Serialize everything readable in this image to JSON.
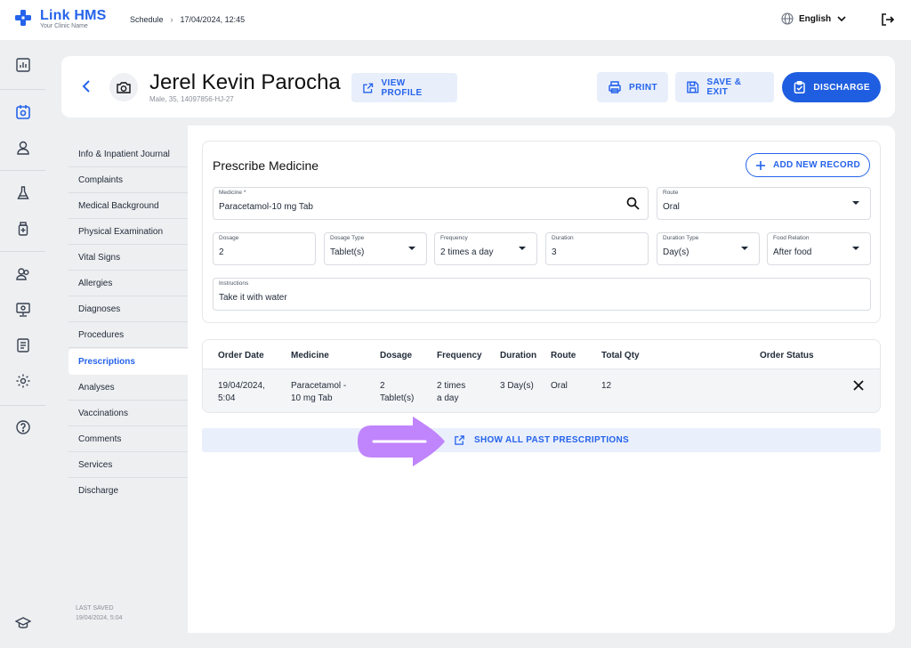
{
  "brand": {
    "name": "Link HMS",
    "subtitle": "Your Clinic Name"
  },
  "breadcrumb": {
    "section": "Schedule",
    "datetime": "17/04/2024, 12:45"
  },
  "language": "English",
  "patient": {
    "name": "Jerel Kevin Parocha",
    "meta": "Male, 35, 14097856-HJ-27",
    "view_profile": "VIEW PROFILE"
  },
  "actions": {
    "print": "PRINT",
    "save_exit": "SAVE & EXIT",
    "discharge": "DISCHARGE"
  },
  "sections": [
    "Info & Inpatient Journal",
    "Complaints",
    "Medical Background",
    "Physical Examination",
    "Vital Signs",
    "Allergies",
    "Diagnoses",
    "Procedures",
    "Prescriptions",
    "Analyses",
    "Vaccinations",
    "Comments",
    "Services",
    "Discharge"
  ],
  "active_section": "Prescriptions",
  "last_saved": {
    "label": "LAST SAVED",
    "value": "19/04/2024, 5:04"
  },
  "prescribe": {
    "title": "Prescribe Medicine",
    "add_record": "ADD NEW RECORD",
    "medicine": {
      "label": "Medicine *",
      "value": "Paracetamol-10 mg Tab"
    },
    "route": {
      "label": "Route",
      "value": "Oral"
    },
    "dosage": {
      "label": "Dosage",
      "value": "2"
    },
    "dosage_type": {
      "label": "Dosage Type",
      "value": "Tablet(s)"
    },
    "frequency": {
      "label": "Frequency",
      "value": "2 times a day"
    },
    "duration": {
      "label": "Duration",
      "value": "3"
    },
    "duration_type": {
      "label": "Duration Type",
      "value": "Day(s)"
    },
    "food_relation": {
      "label": "Food Relation",
      "value": "After food"
    },
    "instructions": {
      "label": "Instructions",
      "value": "Take it with water"
    }
  },
  "table": {
    "headers": [
      "Order Date",
      "Medicine",
      "Dosage",
      "Frequency",
      "Duration",
      "Route",
      "Total Qty",
      "Order Status"
    ],
    "row": {
      "order_date_1": "19/04/2024,",
      "order_date_2": "5:04",
      "medicine_1": "Paracetamol -",
      "medicine_2": "10 mg Tab",
      "dosage_1": "2",
      "dosage_2": "Tablet(s)",
      "frequency_1": "2 times",
      "frequency_2": "a day",
      "duration": "3 Day(s)",
      "route": "Oral",
      "total_qty": "12"
    }
  },
  "show_past": "SHOW ALL PAST PRESCRIPTIONS",
  "colors": {
    "accent": "#2563eb",
    "highlight_arrow": "#c084fc"
  },
  "icons": [
    "logo-cross-icon",
    "globe-icon",
    "chevron-down-icon",
    "logout-icon",
    "back-icon",
    "camera-icon",
    "external-link-icon",
    "printer-icon",
    "save-icon",
    "clipboard-check-icon",
    "plus-icon",
    "search-icon",
    "close-icon",
    "arrow-right-icon"
  ]
}
